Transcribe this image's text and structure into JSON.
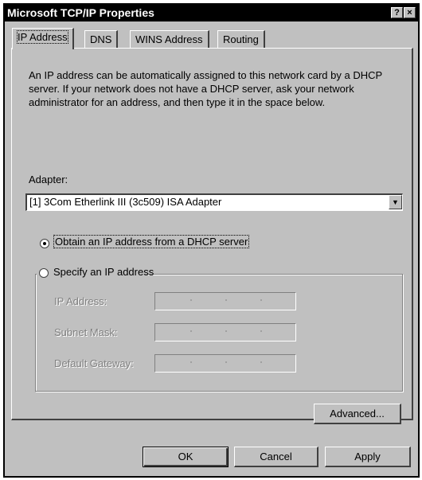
{
  "window": {
    "title": "Microsoft TCP/IP Properties",
    "help_glyph": "?",
    "close_glyph": "×"
  },
  "tabs": [
    {
      "label": "IP Address",
      "active": true
    },
    {
      "label": "DNS",
      "active": false
    },
    {
      "label": "WINS Address",
      "active": false
    },
    {
      "label": "Routing",
      "active": false
    }
  ],
  "description": "An IP address can be automatically assigned to this network card by a DHCP server.  If your network does not have a DHCP server, ask your network administrator for an address, and then type it in the space below.",
  "adapter": {
    "label": "Adapter:",
    "selected": "[1] 3Com Etherlink III (3c509) ISA Adapter",
    "arrow_glyph": "▼"
  },
  "options": {
    "dhcp": {
      "label": "Obtain an IP address from a DHCP server",
      "checked": true
    },
    "specify": {
      "label": "Specify an IP address",
      "checked": false
    }
  },
  "fields": {
    "ip_address_label": "IP Address:",
    "subnet_mask_label": "Subnet Mask:",
    "default_gateway_label": "Default Gateway:"
  },
  "buttons": {
    "advanced": "Advanced...",
    "ok": "OK",
    "cancel": "Cancel",
    "apply": "Apply"
  }
}
